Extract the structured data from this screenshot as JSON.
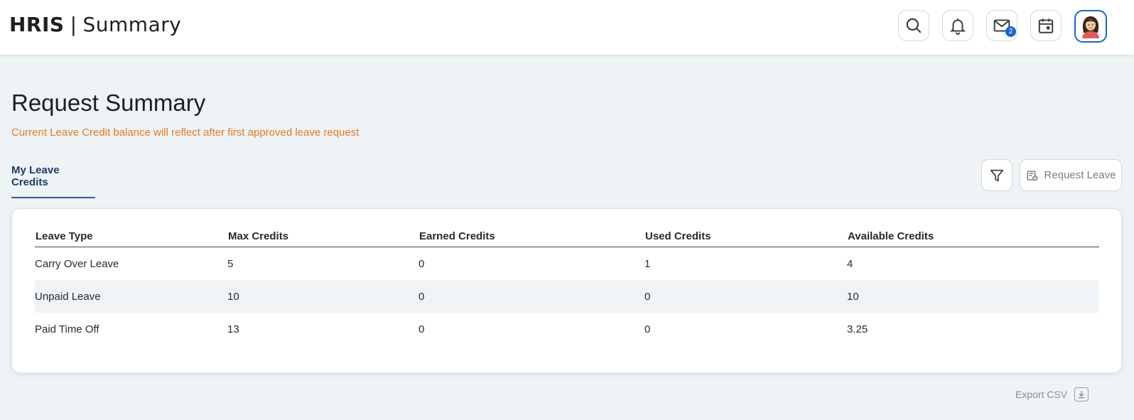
{
  "header": {
    "app_name": "HRIS",
    "separator": "|",
    "page_name": "Summary",
    "mail_badge": "2"
  },
  "main": {
    "title": "Request Summary",
    "notice": "Current Leave Credit balance will reflect after first approved leave request",
    "active_tab": "My Leave Credits",
    "request_leave_label": "Request Leave",
    "export_label": "Export CSV"
  },
  "table": {
    "columns": [
      "Leave Type",
      "Max Credits",
      "Earned Credits",
      "Used Credits",
      "Available Credits"
    ],
    "rows": [
      [
        "Carry Over Leave",
        "5",
        "0",
        "1",
        "4"
      ],
      [
        "Unpaid Leave",
        "10",
        "0",
        "0",
        "10"
      ],
      [
        "Paid Time Off",
        "13",
        "0",
        "0",
        "3.25"
      ]
    ]
  },
  "colors": {
    "accent": "#1565d8",
    "notice": "#ea7a1e",
    "tab": "#1d3c6e",
    "background": "#eef3f6"
  },
  "icons": [
    "search-icon",
    "bell-icon",
    "mail-icon",
    "calendar-icon",
    "avatar",
    "filter-icon",
    "request-leave-icon",
    "download-icon"
  ]
}
